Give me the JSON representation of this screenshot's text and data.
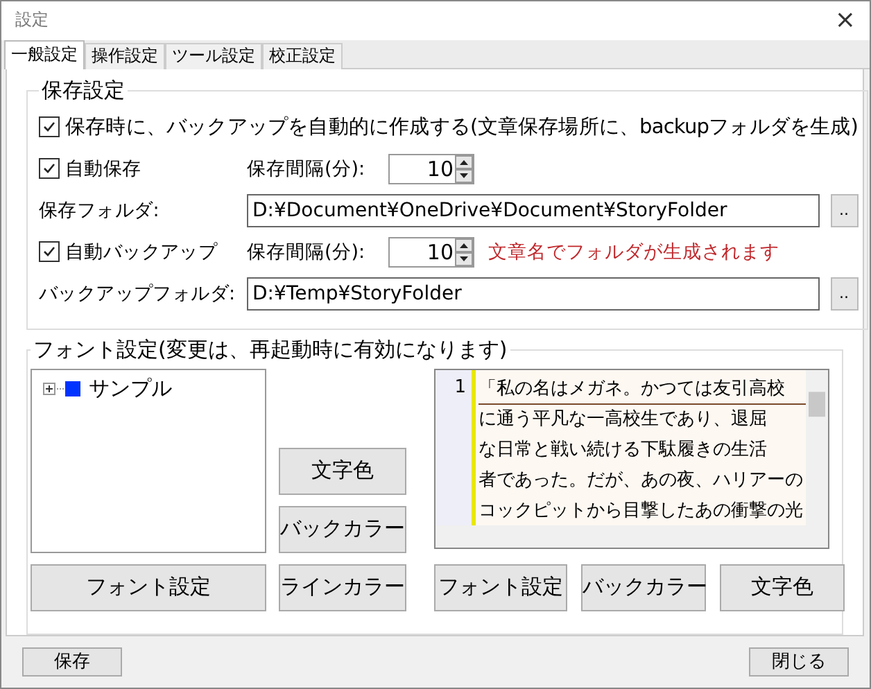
{
  "window": {
    "title": "設定",
    "close": "×"
  },
  "tabs": [
    {
      "label": "一般設定",
      "selected": true
    },
    {
      "label": "操作設定",
      "selected": false
    },
    {
      "label": "ツール設定",
      "selected": false
    },
    {
      "label": "校正設定",
      "selected": false
    }
  ],
  "save_settings": {
    "title": "保存設定",
    "backup_on_save": {
      "label": "保存時に、バックアップを自動的に作成する(文章保存場所に、backupフォルダを生成)",
      "checked": true
    },
    "auto_save": {
      "label": "自動保存",
      "checked": true,
      "interval_label": "保存間隔(分):",
      "interval": "10"
    },
    "save_folder": {
      "label": "保存フォルダ:",
      "value": "D:¥Document¥OneDrive¥Document¥StoryFolder",
      "browse": ".."
    },
    "auto_backup": {
      "label": "自動バックアップ",
      "checked": true,
      "interval_label": "保存間隔(分):",
      "interval": "10",
      "note": "文章名でフォルダが生成されます"
    },
    "backup_folder": {
      "label": "バックアップフォルダ:",
      "value": "D:¥Temp¥StoryFolder",
      "browse": ".."
    }
  },
  "font_settings": {
    "title": "フォント設定(変更は、再起動時に有効になります)",
    "tree": [
      {
        "label": "サンプル",
        "color": "#0033ff",
        "expanded": false
      }
    ],
    "tree_buttons": [
      "文字色",
      "バックカラー",
      "ラインカラー"
    ],
    "tree_font_button": "フォント設定",
    "editor": {
      "line_number": "1",
      "lines": [
        "「私の名はメガネ。かつては友引高校",
        "に通う平凡な一高校生であり、退屈",
        "な日常と戦い続ける下駄履きの生活",
        "者であった。だが、あの夜、ハリアーの",
        "コックピットから目撃したあの衝撃の光"
      ]
    },
    "editor_buttons": [
      "フォント設定",
      "バックカラー",
      "文字色"
    ]
  },
  "footer_buttons": [
    "保存",
    "閉じる"
  ]
}
